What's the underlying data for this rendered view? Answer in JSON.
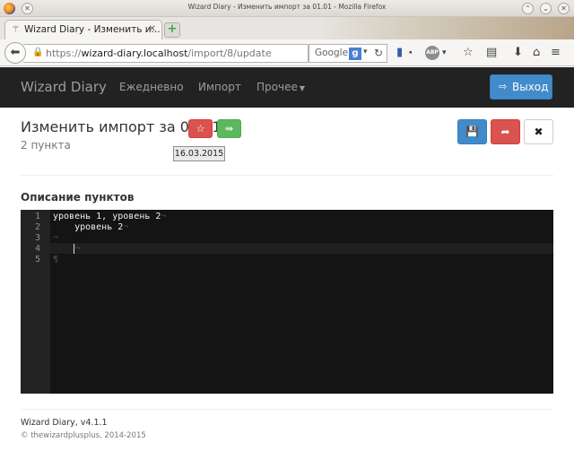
{
  "window": {
    "title": "Wizard Diary - Изменить импорт за 01.01 - Mozilla Firefox"
  },
  "browser": {
    "tab_label": "Wizard Diary - Изменить и...",
    "url_prefix": "https://",
    "url_host": "wizard-diary.localhost",
    "url_path": "/import/8/update",
    "search_engine": "Google"
  },
  "navbar": {
    "brand": "Wizard Diary",
    "items": [
      "Ежедневно",
      "Импорт",
      "Прочее"
    ],
    "logout_label": "Выход"
  },
  "page": {
    "title": "Изменить импорт за 01.01",
    "subtitle": "2 пункта",
    "tooltip": "16.03.2015",
    "section_label": "Описание пунктов"
  },
  "editor": {
    "line_numbers": [
      "1",
      "2",
      "3",
      "4",
      "5"
    ],
    "lines": [
      "уровень 1, уровень 2",
      "    уровень 2",
      "",
      "    ",
      ""
    ]
  },
  "footer": {
    "app": "Wizard Diary, v4.1.1",
    "copyright": "© thewizardplusplus, 2014-2015"
  },
  "colors": {
    "navbar_bg": "#222222",
    "primary": "#428bca",
    "danger": "#d9534f",
    "success": "#5cb85c",
    "editor_bg": "#141414"
  }
}
